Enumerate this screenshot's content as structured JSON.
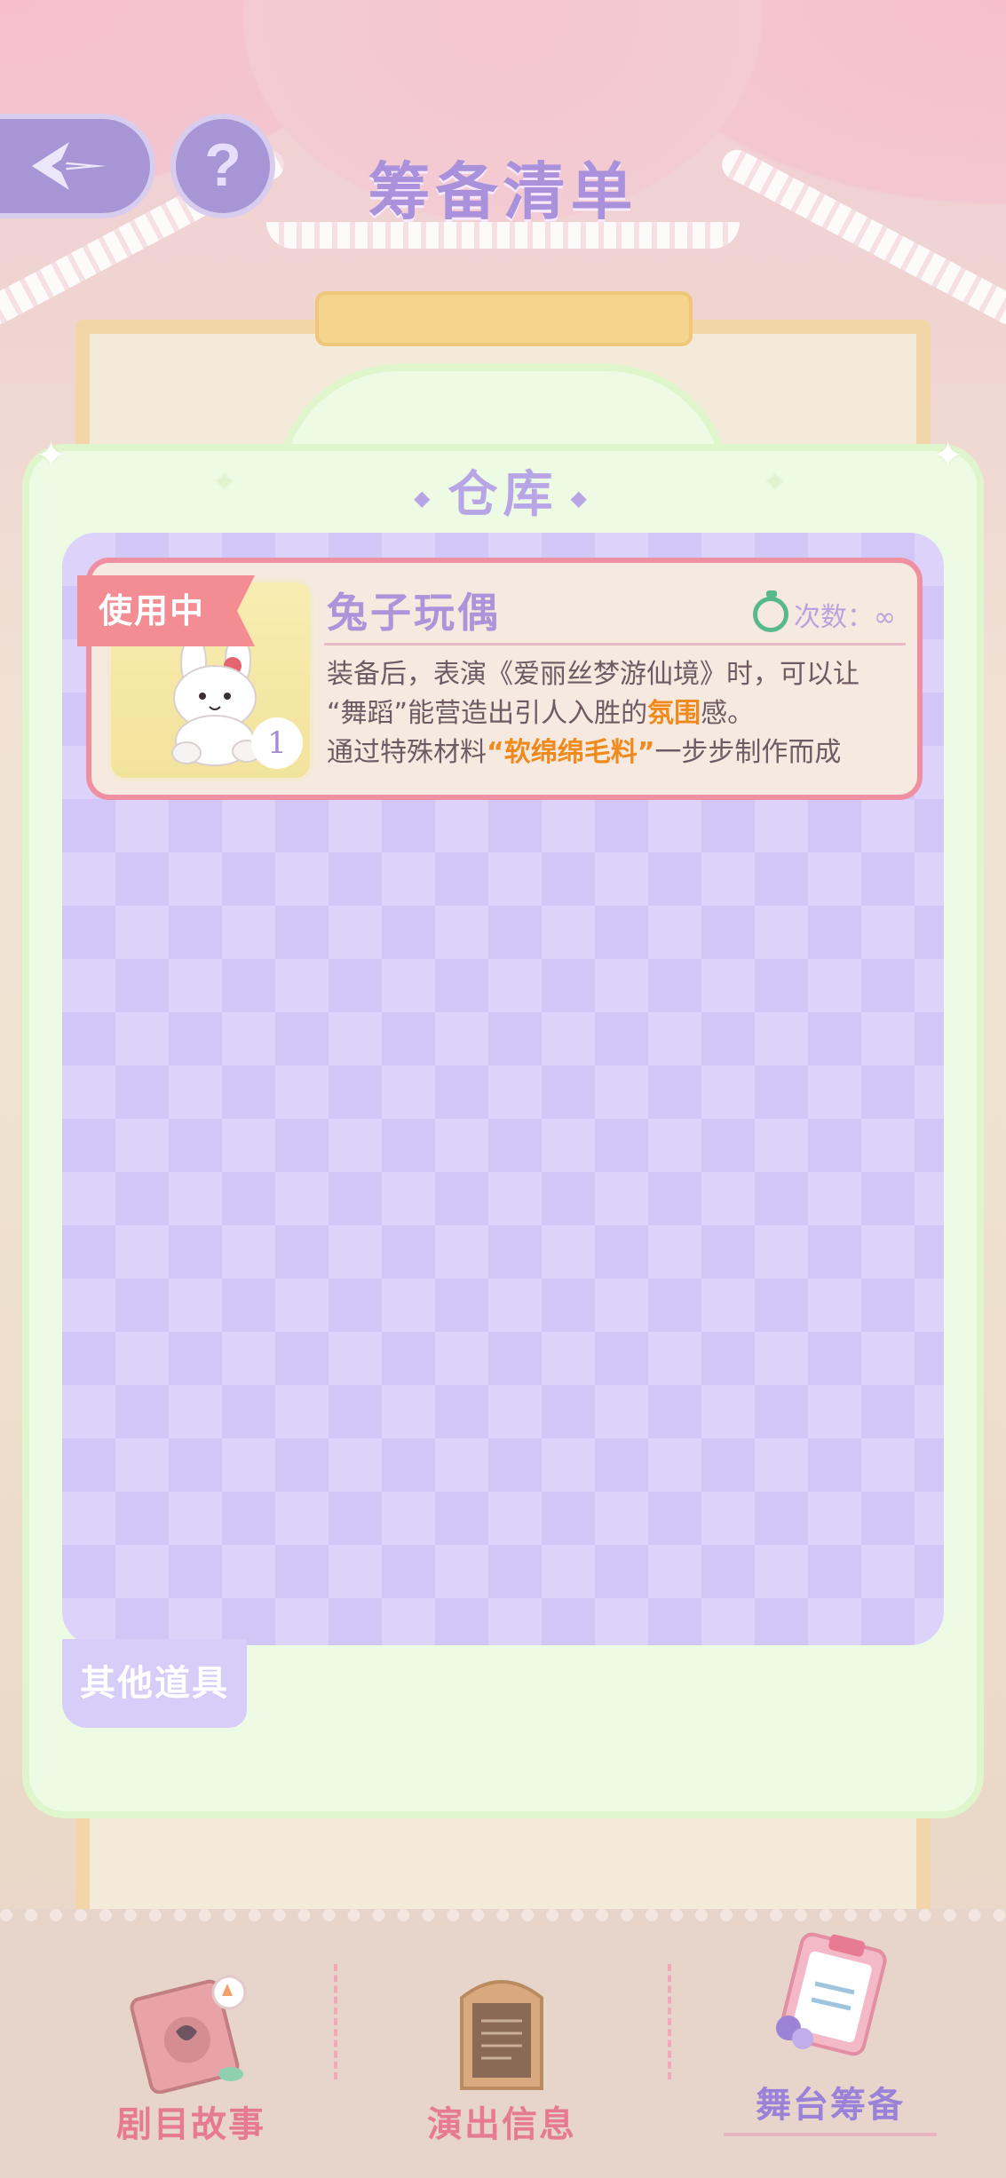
{
  "header": {
    "title": "筹备清单",
    "help_label": "?"
  },
  "panel": {
    "title": "仓库",
    "other_tab_label": "其他道具"
  },
  "item": {
    "status_tag": "使用中",
    "name": "兔子玩偶",
    "uses_label": "次数：∞",
    "quantity": "1",
    "desc_line1": "装备后，表演《爱丽丝梦游仙境》时，可以让",
    "desc_line2_pre": "“舞蹈”能营造出引人入胜的",
    "desc_line2_hl": "氛围",
    "desc_line2_post": "感。",
    "desc_line3_pre": "通过特殊材料",
    "desc_line3_hl": "“软绵绵毛料”",
    "desc_line3_post": "一步步制作而成"
  },
  "bottom_nav": {
    "items": [
      {
        "label": "剧目故事",
        "icon": "story-book-icon"
      },
      {
        "label": "演出信息",
        "icon": "info-board-icon"
      },
      {
        "label": "舞台筹备",
        "icon": "clipboard-icon"
      }
    ]
  },
  "colors": {
    "accent_purple": "#a992db",
    "highlight_orange": "#f08a1d",
    "tag_pink": "#f48c93"
  }
}
